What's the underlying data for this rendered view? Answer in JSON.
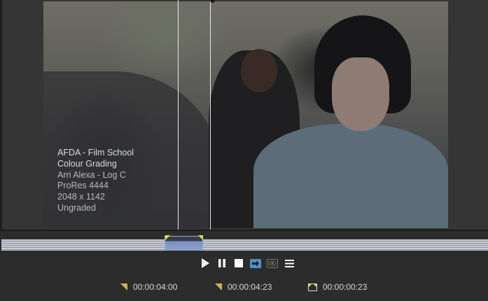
{
  "viewer": {
    "overlay": {
      "title": "AFDA - Film School",
      "subtitle": "Colour Grading",
      "camera": "Arri Alexa - Log C",
      "codec": "ProRes 4444",
      "resolution": "2048 x 1142",
      "status": "Ungraded"
    }
  },
  "transport": {
    "buttons": [
      {
        "name": "play-button",
        "icon": "play-icon"
      },
      {
        "name": "pause-button",
        "icon": "pause-icon"
      },
      {
        "name": "stop-button",
        "icon": "stop-icon"
      },
      {
        "name": "loop-button",
        "icon": "loop-icon",
        "active": true
      },
      {
        "name": "preview-button",
        "icon": "eye-icon",
        "active": false
      },
      {
        "name": "menu-button",
        "icon": "menu-icon"
      }
    ]
  },
  "timecodes": {
    "in_point": "00:00:04:00",
    "out_point": "00:00:04:23",
    "duration": "00:00:00:23"
  },
  "colors": {
    "accent": "#e9dc3a",
    "selection": "#8aa0d0",
    "active_button": "#4f8fc6"
  }
}
